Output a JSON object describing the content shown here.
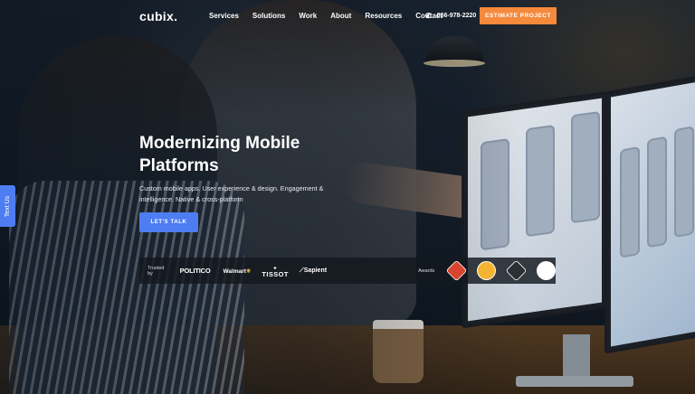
{
  "nav": {
    "logo": "cubix.",
    "links": [
      "Services",
      "Solutions",
      "Work",
      "About",
      "Resources",
      "Contact"
    ],
    "phone": "866-978-2220",
    "estimate_label": "ESTIMATE PROJECT"
  },
  "hero": {
    "headline": "Modernizing Mobile Platforms",
    "subtext": "Custom mobile apps. User experience & design. Engagement & intelligence. Native & cross-platform",
    "cta_label": "LET'S TALK"
  },
  "trusted": {
    "label": "Trusted by",
    "brands": [
      "POLITICO",
      "Walmart",
      "TISSOT",
      "Sapient"
    ],
    "awards_label": "Awards",
    "awards": [
      "award-badge-1",
      "award-badge-2",
      "award-badge-3",
      "award-badge-4"
    ]
  },
  "side_tab": {
    "label": "Text Us"
  },
  "colors": {
    "accent_orange": "#f58a3d",
    "accent_blue": "#4e7df2"
  },
  "icons": {
    "phone": "phone-icon"
  }
}
